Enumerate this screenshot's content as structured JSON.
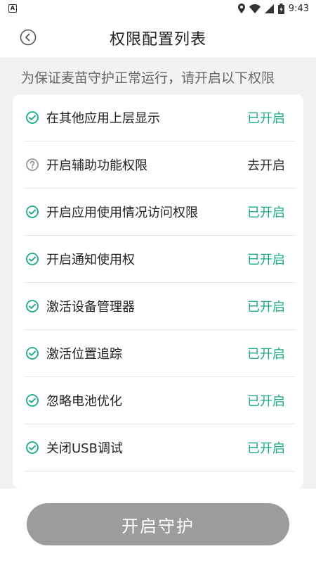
{
  "statusbar": {
    "notification_icon": "android-notification-icon",
    "time": "9:43"
  },
  "header": {
    "title": "权限配置列表",
    "back_icon": "back-icon"
  },
  "notice": "为保证麦苗守护正常运行，请开启以下权限",
  "colors": {
    "enabled": "#1aaa8a",
    "button": "#9c9c9c"
  },
  "permissions": [
    {
      "label": "在其他应用上层显示",
      "status": "已开启",
      "icon": "check-circle-icon"
    },
    {
      "label": "开启辅助功能权限",
      "status": "去开启",
      "icon": "question-circle-icon"
    },
    {
      "label": "开启应用使用情况访问权限",
      "status": "已开启",
      "icon": "check-circle-icon"
    },
    {
      "label": "开启通知使用权",
      "status": "已开启",
      "icon": "check-circle-icon"
    },
    {
      "label": "激活设备管理器",
      "status": "已开启",
      "icon": "check-circle-icon"
    },
    {
      "label": "激活位置追踪",
      "status": "已开启",
      "icon": "check-circle-icon"
    },
    {
      "label": "忽略电池优化",
      "status": "已开启",
      "icon": "check-circle-icon"
    },
    {
      "label": "关闭USB调试",
      "status": "已开启",
      "icon": "check-circle-icon"
    }
  ],
  "bottom": {
    "start_label": "开启守护"
  }
}
